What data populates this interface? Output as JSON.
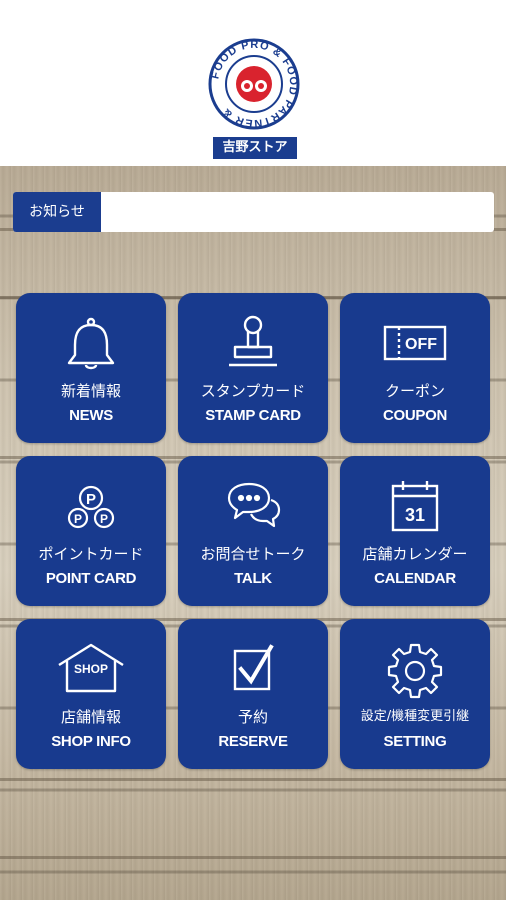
{
  "header": {
    "logo_ring_text": "FOOD PRO & FOOD PARTNER &",
    "brand_name": "吉野ストア"
  },
  "news": {
    "label": "お知らせ",
    "content": ""
  },
  "menu": [
    {
      "jp": "新着情報",
      "en": "NEWS",
      "icon": "bell-icon"
    },
    {
      "jp": "スタンプカード",
      "en": "STAMP CARD",
      "icon": "stamp-icon"
    },
    {
      "jp": "クーポン",
      "en": "COUPON",
      "icon": "coupon-off-icon",
      "icon_text": "OFF"
    },
    {
      "jp": "ポイントカード",
      "en": "POINT CARD",
      "icon": "point-coins-icon",
      "icon_text": "P"
    },
    {
      "jp": "お問合せトーク",
      "en": "TALK",
      "icon": "chat-bubbles-icon"
    },
    {
      "jp": "店舗カレンダー",
      "en": "CALENDAR",
      "icon": "calendar-icon",
      "icon_text": "31"
    },
    {
      "jp": "店舗情報",
      "en": "SHOP INFO",
      "icon": "shop-icon",
      "icon_text": "SHOP"
    },
    {
      "jp": "予約",
      "en": "RESERVE",
      "icon": "checkbox-icon"
    },
    {
      "jp": "設定/機種変更引継",
      "en": "SETTING",
      "icon": "gear-icon"
    }
  ],
  "colors": {
    "primary": "#183a8e",
    "logo_red": "#d9232e",
    "white": "#ffffff"
  }
}
